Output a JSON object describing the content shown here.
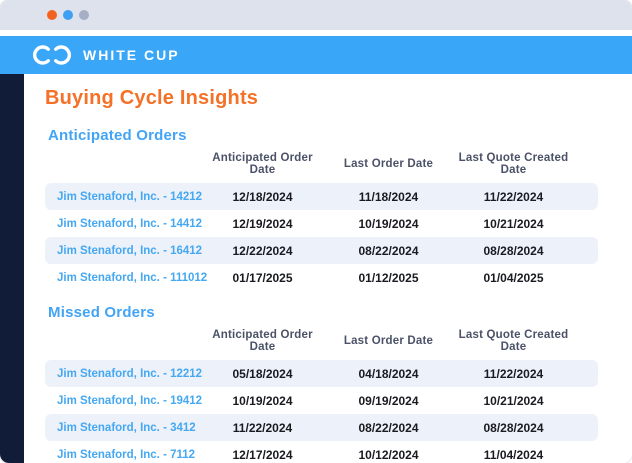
{
  "window": {
    "controls": [
      "close",
      "minimize",
      "maximize"
    ]
  },
  "brand": {
    "name": "WHITE CUP"
  },
  "page": {
    "title": "Buying Cycle Insights"
  },
  "table_columns": [
    "Anticipated Order Date",
    "Last Order Date",
    "Last Quote Created Date"
  ],
  "sections": [
    {
      "title": "Anticipated Orders",
      "rows": [
        {
          "customer": "Jim Stenaford, Inc. - 14212",
          "dates": [
            "12/18/2024",
            "11/18/2024",
            "11/22/2024"
          ]
        },
        {
          "customer": "Jim Stenaford, Inc. - 14412",
          "dates": [
            "12/19/2024",
            "10/19/2024",
            "10/21/2024"
          ]
        },
        {
          "customer": "Jim Stenaford, Inc. - 16412",
          "dates": [
            "12/22/2024",
            "08/22/2024",
            "08/28/2024"
          ]
        },
        {
          "customer": "Jim Stenaford, Inc. - 111012",
          "dates": [
            "01/17/2025",
            "01/12/2025",
            "01/04/2025"
          ]
        }
      ]
    },
    {
      "title": "Missed Orders",
      "rows": [
        {
          "customer": "Jim Stenaford, Inc. - 12212",
          "dates": [
            "05/18/2024",
            "04/18/2024",
            "11/22/2024"
          ]
        },
        {
          "customer": "Jim Stenaford, Inc. - 19412",
          "dates": [
            "10/19/2024",
            "09/19/2024",
            "10/21/2024"
          ]
        },
        {
          "customer": "Jim Stenaford, Inc. - 3412",
          "dates": [
            "11/22/2024",
            "08/22/2024",
            "08/28/2024"
          ]
        },
        {
          "customer": "Jim Stenaford, Inc. - 7112",
          "dates": [
            "12/17/2024",
            "10/12/2024",
            "11/04/2024"
          ]
        }
      ]
    }
  ],
  "colors": {
    "titlebar_bg": "#dee2ed",
    "dot_orange": "#f4621f",
    "dot_blue": "#3f9ff3",
    "dot_gray": "#a6aec5",
    "appbar_blue": "#3aa6f8",
    "left_rail_navy": "#111c38",
    "title_orange": "#f47127",
    "section_blue": "#42a4f5",
    "link_blue": "#45a8f1",
    "row_alt_bg": "#edf1f9",
    "header_text": "#4b5268",
    "date_text": "#191b20"
  }
}
